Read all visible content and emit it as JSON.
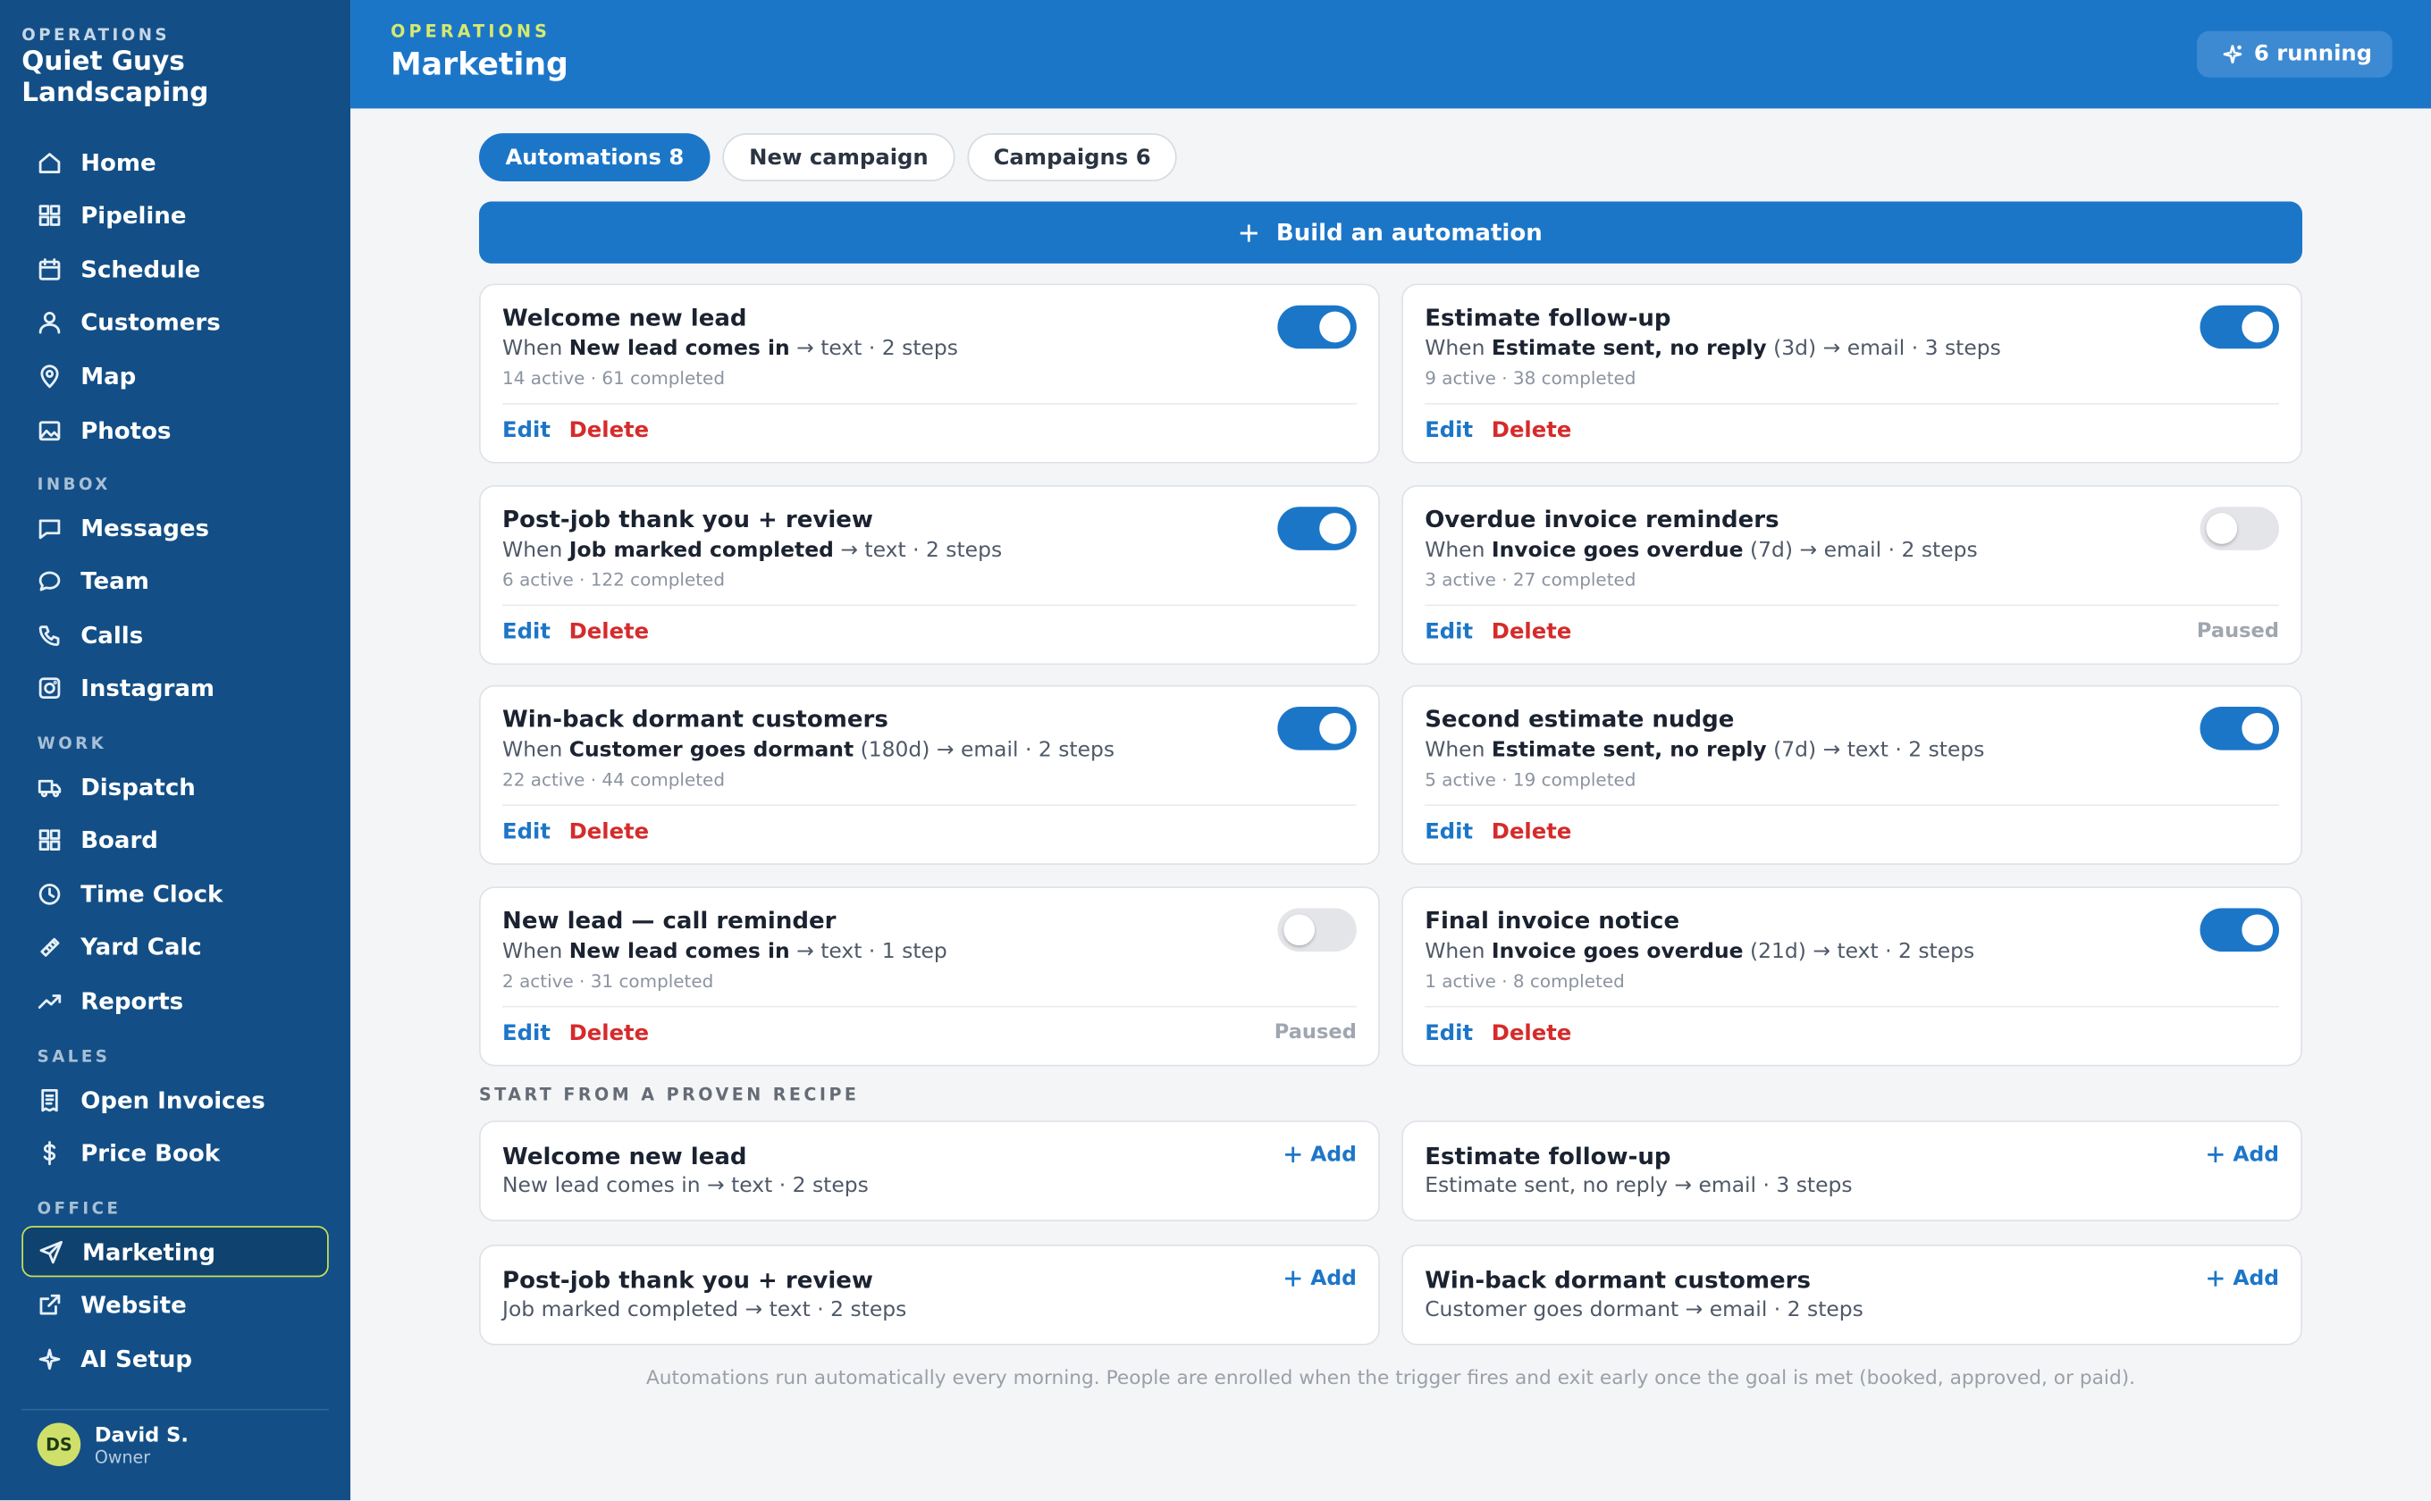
{
  "brand": {
    "label": "OPERATIONS",
    "name": "Quiet Guys Landscaping"
  },
  "nav": {
    "main": [
      {
        "label": "Home",
        "icon": "home-icon"
      },
      {
        "label": "Pipeline",
        "icon": "grid-icon"
      },
      {
        "label": "Schedule",
        "icon": "calendar-icon"
      },
      {
        "label": "Customers",
        "icon": "user-icon"
      },
      {
        "label": "Map",
        "icon": "map-pin-icon"
      },
      {
        "label": "Photos",
        "icon": "image-icon"
      }
    ],
    "inbox_label": "INBOX",
    "inbox": [
      {
        "label": "Messages",
        "icon": "message-square-icon"
      },
      {
        "label": "Team",
        "icon": "chat-bubble-icon"
      },
      {
        "label": "Calls",
        "icon": "phone-icon"
      },
      {
        "label": "Instagram",
        "icon": "instagram-icon"
      }
    ],
    "work_label": "WORK",
    "work": [
      {
        "label": "Dispatch",
        "icon": "truck-icon"
      },
      {
        "label": "Board",
        "icon": "board-icon"
      },
      {
        "label": "Time Clock",
        "icon": "clock-icon"
      },
      {
        "label": "Yard Calc",
        "icon": "ruler-icon"
      },
      {
        "label": "Reports",
        "icon": "trending-up-icon"
      }
    ],
    "sales_label": "SALES",
    "sales": [
      {
        "label": "Open Invoices",
        "icon": "receipt-icon"
      },
      {
        "label": "Price Book",
        "icon": "dollar-icon"
      }
    ],
    "office_label": "OFFICE",
    "office": [
      {
        "label": "Marketing",
        "icon": "send-icon"
      },
      {
        "label": "Website",
        "icon": "external-link-icon"
      },
      {
        "label": "AI Setup",
        "icon": "sparkle-icon"
      }
    ]
  },
  "user": {
    "initials": "DS",
    "name": "David S.",
    "role": "Owner"
  },
  "header": {
    "crumb": "OPERATIONS",
    "title": "Marketing",
    "running": "6 running"
  },
  "tabs": [
    "Automations 8",
    "New campaign",
    "Campaigns 6"
  ],
  "build_label": "Build an automation",
  "actions": {
    "edit": "Edit",
    "delete": "Delete",
    "paused": "Paused",
    "add": "Add"
  },
  "automations": [
    {
      "name": "Welcome new lead",
      "when": "When",
      "trigger": "New lead comes in",
      "delay": "",
      "rest": "→ text · 2 steps",
      "stats": "14 active · 61 completed",
      "enabled": true
    },
    {
      "name": "Estimate follow-up",
      "when": "When",
      "trigger": "Estimate sent, no reply",
      "delay": "(3d)",
      "rest": "→ email · 3 steps",
      "stats": "9 active · 38 completed",
      "enabled": true
    },
    {
      "name": "Post-job thank you + review",
      "when": "When",
      "trigger": "Job marked completed",
      "delay": "",
      "rest": "→ text · 2 steps",
      "stats": "6 active · 122 completed",
      "enabled": true
    },
    {
      "name": "Overdue invoice reminders",
      "when": "When",
      "trigger": "Invoice goes overdue",
      "delay": "(7d)",
      "rest": "→ email · 2 steps",
      "stats": "3 active · 27 completed",
      "enabled": false
    },
    {
      "name": "Win-back dormant customers",
      "when": "When",
      "trigger": "Customer goes dormant",
      "delay": "(180d)",
      "rest": "→ email · 2 steps",
      "stats": "22 active · 44 completed",
      "enabled": true
    },
    {
      "name": "Second estimate nudge",
      "when": "When",
      "trigger": "Estimate sent, no reply",
      "delay": "(7d)",
      "rest": "→ text · 2 steps",
      "stats": "5 active · 19 completed",
      "enabled": true
    },
    {
      "name": "New lead — call reminder",
      "when": "When",
      "trigger": "New lead comes in",
      "delay": "",
      "rest": "→ text · 1 step",
      "stats": "2 active · 31 completed",
      "enabled": false
    },
    {
      "name": "Final invoice notice",
      "when": "When",
      "trigger": "Invoice goes overdue",
      "delay": "(21d)",
      "rest": "→ text · 2 steps",
      "stats": "1 active · 8 completed",
      "enabled": true
    }
  ],
  "recipes_heading": "START FROM A PROVEN RECIPE",
  "recipes": [
    {
      "name": "Welcome new lead",
      "desc": "New lead comes in → text · 2 steps"
    },
    {
      "name": "Estimate follow-up",
      "desc": "Estimate sent, no reply → email · 3 steps"
    },
    {
      "name": "Post-job thank you + review",
      "desc": "Job marked completed → text · 2 steps"
    },
    {
      "name": "Win-back dormant customers",
      "desc": "Customer goes dormant → email · 2 steps"
    }
  ],
  "footnote": "Automations run automatically every morning. People are enrolled when the trigger fires and exit early once the goal is met (booked, approved, or paid).",
  "colors": {
    "sidebar": "#134f86",
    "primary": "#1c76c8",
    "danger": "#d52b2b",
    "accent": "#cfe06a"
  }
}
